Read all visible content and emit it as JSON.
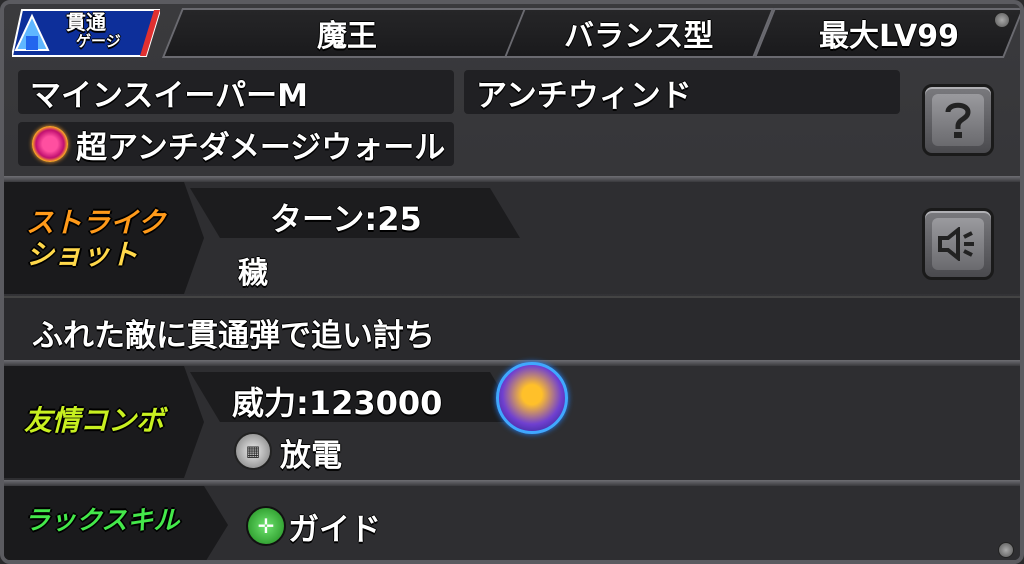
{
  "badge": {
    "line1": "貫通",
    "line2": "ゲージ",
    "amp": "&"
  },
  "header": {
    "tribe": "魔王",
    "type": "バランス型",
    "max_level": "最大LV99"
  },
  "abilities": {
    "ability1": "マインスイーパーM",
    "ability2": "アンチウィンド",
    "gauge_ability": "超アンチダメージウォール"
  },
  "strike_shot": {
    "label_line1": "ストライク",
    "label_line2": "ショット",
    "turns": "ターン:25",
    "name": "穢",
    "description": "ふれた敵に貫通弾で追い討ち"
  },
  "friendship_combo": {
    "label": "友情コンボ",
    "power": "威力:123000",
    "name": "放電"
  },
  "luck_skill": {
    "label": "ラックスキル",
    "name": "ガイド"
  },
  "buttons": {
    "help": "?",
    "voice": "speaker"
  },
  "colors": {
    "strike_label": "#ff9a1a",
    "combo_label": "#c8f020",
    "luck_label": "#44e84a",
    "badge_blue": "#1a4fd8"
  }
}
